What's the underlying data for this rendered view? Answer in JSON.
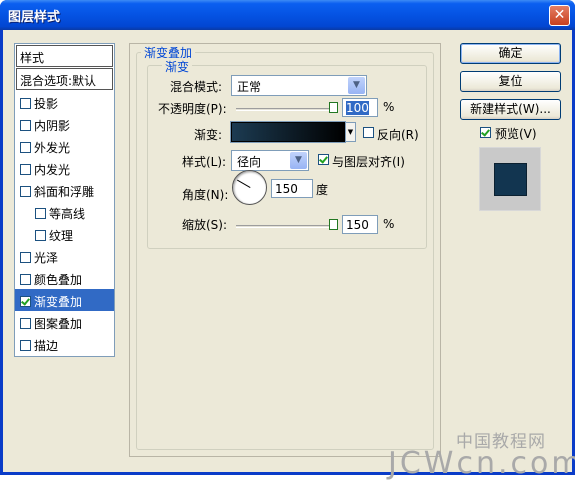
{
  "window": {
    "title": "图层样式",
    "close": "✕"
  },
  "left_panel": {
    "header1": "样式",
    "header2": "混合选项:默认",
    "items": [
      {
        "label": "投影",
        "checked": false,
        "sub": false,
        "selected": false
      },
      {
        "label": "内阴影",
        "checked": false,
        "sub": false,
        "selected": false
      },
      {
        "label": "外发光",
        "checked": false,
        "sub": false,
        "selected": false
      },
      {
        "label": "内发光",
        "checked": false,
        "sub": false,
        "selected": false
      },
      {
        "label": "斜面和浮雕",
        "checked": false,
        "sub": false,
        "selected": false
      },
      {
        "label": "等高线",
        "checked": false,
        "sub": true,
        "selected": false
      },
      {
        "label": "纹理",
        "checked": false,
        "sub": true,
        "selected": false
      },
      {
        "label": "光泽",
        "checked": false,
        "sub": false,
        "selected": false
      },
      {
        "label": "颜色叠加",
        "checked": false,
        "sub": false,
        "selected": false
      },
      {
        "label": "渐变叠加",
        "checked": true,
        "sub": false,
        "selected": true
      },
      {
        "label": "图案叠加",
        "checked": false,
        "sub": false,
        "selected": false
      },
      {
        "label": "描边",
        "checked": false,
        "sub": false,
        "selected": false
      }
    ]
  },
  "gradient_overlay": {
    "section_title": "渐变叠加",
    "group_title": "渐变",
    "blend_mode_label": "混合模式:",
    "blend_mode_value": "正常",
    "opacity_label": "不透明度(P):",
    "opacity_value": "100",
    "opacity_level": 1.0,
    "percent": "%",
    "gradient_label": "渐变:",
    "reverse_label": "反向(R)",
    "reverse_checked": false,
    "style_label": "样式(L):",
    "style_value": "径向",
    "align_label": "与图层对齐(I)",
    "align_checked": true,
    "angle_label": "角度(N):",
    "angle_value": "150",
    "angle_unit": "度",
    "scale_label": "缩放(S):",
    "scale_value": "150",
    "scale_level": 1.0,
    "gradient_colors": [
      "#1c3b52",
      "#000000"
    ]
  },
  "buttons": {
    "ok": "确定",
    "reset": "复位",
    "new_style": "新建样式(W)...",
    "preview_label": "预览(V)",
    "preview_checked": true
  },
  "preview": {
    "color": "#123550"
  },
  "watermark": {
    "top": "中国教程网",
    "bottom": "JCWcn.com"
  }
}
